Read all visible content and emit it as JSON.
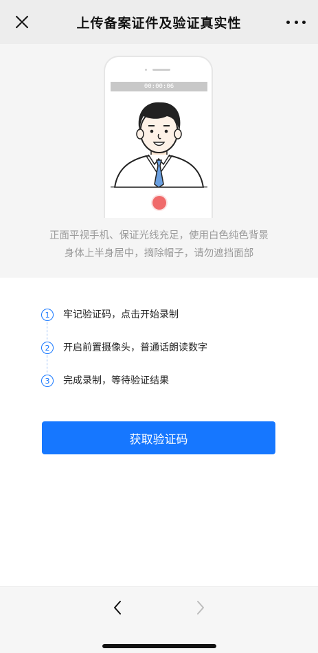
{
  "header": {
    "title": "上传备案证件及验证真实性",
    "close_icon": "close-icon",
    "more_icon": "more-icon"
  },
  "hero": {
    "timer": "00:00:06",
    "tips_line1": "正面平视手机、保证光线充足，使用白色纯色背景",
    "tips_line2": "身体上半身居中，摘除帽子，请勿遮挡面部",
    "illustration": "person-avatar",
    "record_color": "#f06a6a"
  },
  "steps": [
    {
      "number": "1",
      "text": "牢记验证码，点击开始录制"
    },
    {
      "number": "2",
      "text": "开启前置摄像头，普通话朗读数字"
    },
    {
      "number": "3",
      "text": "完成录制，等待验证结果"
    }
  ],
  "button": {
    "label": "获取验证码",
    "color": "#1677ff"
  },
  "bottom_bar": {
    "back_icon": "chevron-left-icon",
    "forward_icon": "chevron-right-icon"
  }
}
